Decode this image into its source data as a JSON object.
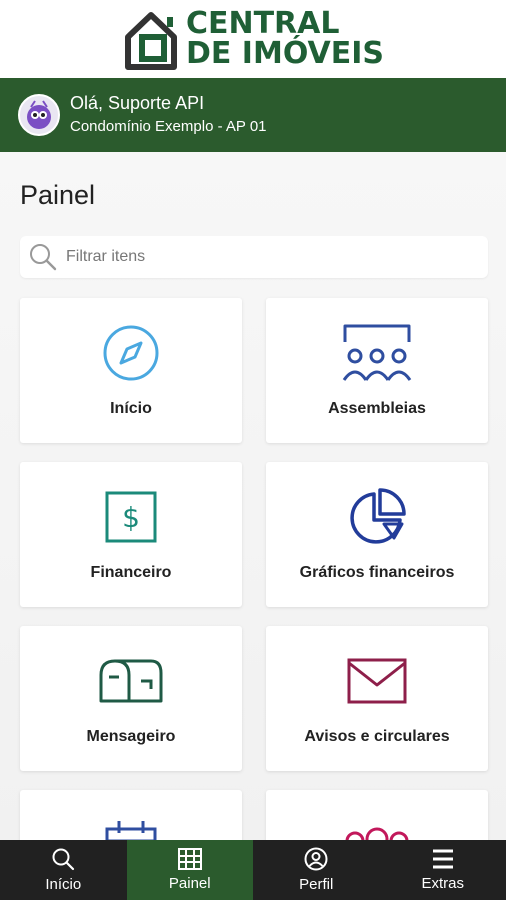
{
  "brand": {
    "line1": "CENTRAL",
    "line2": "DE IMÓVEIS",
    "color": "#1f5f36"
  },
  "user": {
    "greeting": "Olá, Suporte API",
    "unit": "Condomínio Exemplo - AP 01"
  },
  "page": {
    "title": "Painel"
  },
  "search": {
    "placeholder": "Filtrar itens",
    "value": ""
  },
  "cards": [
    {
      "label": "Início",
      "icon": "compass-icon",
      "color": "#4aa8e0"
    },
    {
      "label": "Assembleias",
      "icon": "people-group-icon",
      "color": "#2f4ea0"
    },
    {
      "label": "Financeiro",
      "icon": "dollar-icon",
      "color": "#1b8a7a"
    },
    {
      "label": "Gráficos financeiros",
      "icon": "pie-chart-icon",
      "color": "#223c9a"
    },
    {
      "label": "Mensageiro",
      "icon": "mailbox-icon",
      "color": "#1f5a45"
    },
    {
      "label": "Avisos e circulares",
      "icon": "envelope-icon",
      "color": "#8e1f4a"
    },
    {
      "label": "",
      "icon": "calendar-icon",
      "color": "#2f4ea0"
    },
    {
      "label": "",
      "icon": "circles-icon",
      "color": "#c2185b"
    }
  ],
  "bottom_nav": [
    {
      "label": "Início",
      "icon": "search-icon",
      "active": false
    },
    {
      "label": "Painel",
      "icon": "grid-icon",
      "active": true
    },
    {
      "label": "Perfil",
      "icon": "user-circle-icon",
      "active": false
    },
    {
      "label": "Extras",
      "icon": "menu-icon",
      "active": false
    }
  ],
  "colors": {
    "header_green": "#2b5b2d",
    "nav_dark": "#212121"
  }
}
